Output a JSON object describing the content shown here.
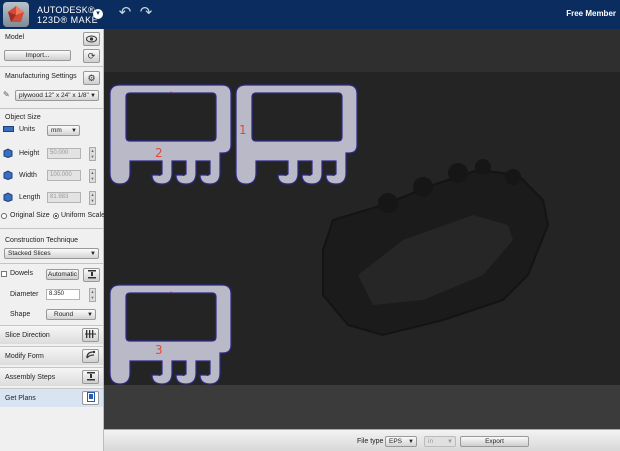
{
  "app": {
    "brand_line1": "AUTODESK®",
    "brand_line2": "123D® MAKE",
    "member": "Free Member",
    "undo_glyph": "↶",
    "redo_glyph": "↷",
    "menu_glyph": "▾"
  },
  "sidebar": {
    "model": {
      "label": "Model",
      "import_label": "Import..."
    },
    "manufacturing": {
      "label": "Manufacturing Settings",
      "material": "plywood 12\" x 24\" x 1/8\""
    },
    "object_size": {
      "label": "Object Size",
      "units_label": "Units",
      "units_value": "mm",
      "height_label": "Height",
      "height_value": "50.000",
      "width_label": "Width",
      "width_value": "100.000",
      "length_label": "Length",
      "length_value": "81.983",
      "original_label": "Original Size",
      "uniform_label": "Uniform Scale"
    },
    "construction": {
      "label": "Construction Technique",
      "technique": "Stacked Slices",
      "dowels_label": "Dowels",
      "dowels_mode": "Automatic",
      "diameter_label": "Diameter",
      "diameter_value": "8.350",
      "shape_label": "Shape",
      "shape_value": "Round"
    },
    "slice_direction": "Slice Direction",
    "modify_form": "Modify Form",
    "assembly_steps": "Assembly Steps",
    "get_plans": "Get Plans"
  },
  "canvas": {
    "pieces": [
      {
        "number": "2"
      },
      {
        "number": "1"
      },
      {
        "number": "3"
      }
    ]
  },
  "bottombar": {
    "file_type_label": "File type",
    "file_type_value": "EPS",
    "unit_value": "in",
    "export_label": "Export"
  },
  "colors": {
    "topbar": "#0a2c5e",
    "piece_fill": "#b9b9c8",
    "piece_stroke": "#2e2a8a",
    "number": "#e04a3a"
  }
}
